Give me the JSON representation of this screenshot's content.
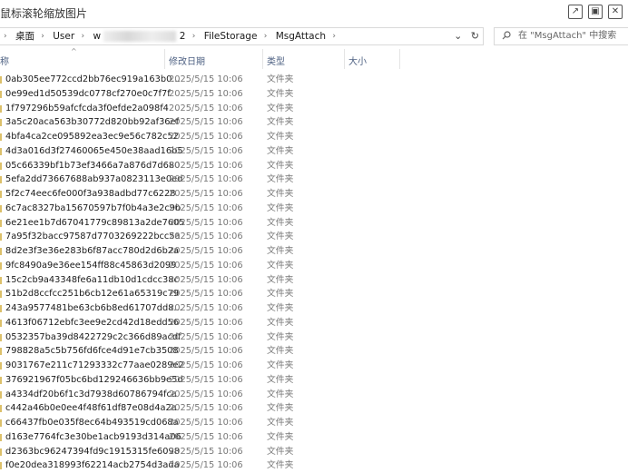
{
  "window": {
    "title": "鼠标滚轮缩放图片",
    "controls": [
      "↗",
      "▣",
      "✕"
    ]
  },
  "address": {
    "chev": "›",
    "crumbs": [
      "桌面",
      "User",
      "w",
      "2",
      "FileStorage",
      "MsgAttach"
    ],
    "dropdown": "⌄",
    "refresh": "↻"
  },
  "search": {
    "placeholder": "在 \"MsgAttach\" 中搜索"
  },
  "columns": {
    "name": "称",
    "date": "修改日期",
    "type": "类型",
    "size": "大小",
    "sort": "^"
  },
  "rows": [
    {
      "name": "0ab305ee772ccd2bb76ec919a163b0...",
      "date": "2025/5/15 10:06",
      "type": "文件夹"
    },
    {
      "name": "0e99ed1d50539dc0778cf270e0c7f7f",
      "date": "2025/5/15 10:06",
      "type": "文件夹"
    },
    {
      "name": "1f797296b59afcfcda3f0efde2a098f4",
      "date": "2025/5/15 10:06",
      "type": "文件夹"
    },
    {
      "name": "3a5c20aca563b30772d820bb92af36ef",
      "date": "2025/5/15 10:06",
      "type": "文件夹"
    },
    {
      "name": "4bfa4ca2ce095892ea3ec9e56c782c52",
      "date": "2025/5/15 10:06",
      "type": "文件夹"
    },
    {
      "name": "4d3a016d3f27460065e450e38aad16b5",
      "date": "2025/5/15 10:06",
      "type": "文件夹"
    },
    {
      "name": "05c66339bf1b73ef3466a7a876d7d680",
      "date": "2025/5/15 10:06",
      "type": "文件夹"
    },
    {
      "name": "5efa2dd73667688ab937a0823113e0ed",
      "date": "2025/5/15 10:06",
      "type": "文件夹"
    },
    {
      "name": "5f2c74eec6fe000f3a938adbd77c6228",
      "date": "2025/5/15 10:06",
      "type": "文件夹"
    },
    {
      "name": "6c7ac8327ba15670597b7f0b4a3e2c9b",
      "date": "2025/5/15 10:06",
      "type": "文件夹"
    },
    {
      "name": "6e21ee1b7d67041779c89813a2de7605",
      "date": "2025/5/15 10:06",
      "type": "文件夹"
    },
    {
      "name": "7a95f32bacc97587d7703269222bcc5a",
      "date": "2025/5/15 10:06",
      "type": "文件夹"
    },
    {
      "name": "8d2e3f3e36e283b6f87acc780d2d6b2a",
      "date": "2025/5/15 10:06",
      "type": "文件夹"
    },
    {
      "name": "9fc8490a9e36ee154ff88c45863d2099",
      "date": "2025/5/15 10:06",
      "type": "文件夹"
    },
    {
      "name": "15c2cb9a43348fe6a11db10d1cdcc38c",
      "date": "2025/5/15 10:06",
      "type": "文件夹"
    },
    {
      "name": "51b2d8ccfcc251b6cb12e61a65319c79",
      "date": "2025/5/15 10:06",
      "type": "文件夹"
    },
    {
      "name": "243a9577481be63cb6b8ed61707dd8...",
      "date": "2025/5/15 10:06",
      "type": "文件夹"
    },
    {
      "name": "4613f06712ebfc3ee9e2cd42d18edd56",
      "date": "2025/5/15 10:06",
      "type": "文件夹"
    },
    {
      "name": "0532357ba39d8422729c2c366d89acdf",
      "date": "2025/5/15 10:06",
      "type": "文件夹"
    },
    {
      "name": "798828a5c5b756fd6fce4d91e7cb3508",
      "date": "2025/5/15 10:06",
      "type": "文件夹"
    },
    {
      "name": "9031767e211c71293332c77aae0289e2",
      "date": "2025/5/15 10:06",
      "type": "文件夹"
    },
    {
      "name": "376921967f05bc6bd129246636bb9e5d",
      "date": "2025/5/15 10:06",
      "type": "文件夹"
    },
    {
      "name": "a4334df20b6f1c3d7938d60786794fca",
      "date": "2025/5/15 10:06",
      "type": "文件夹"
    },
    {
      "name": "c442a46b0e0ee4f48f61df87e08d4a2a",
      "date": "2025/5/15 10:06",
      "type": "文件夹"
    },
    {
      "name": "c66437fb0e035f8ec64b493519cd068a",
      "date": "2025/5/15 10:06",
      "type": "文件夹"
    },
    {
      "name": "d163e7764fc3e30be1acb9193d314a06",
      "date": "2025/5/15 10:06",
      "type": "文件夹"
    },
    {
      "name": "d2363bc96247394fd9c1915315fe6098",
      "date": "2025/5/15 10:06",
      "type": "文件夹"
    },
    {
      "name": "f0e20dea318993f62214acb2754d3ada",
      "date": "2025/5/15 10:06",
      "type": "文件夹"
    }
  ]
}
